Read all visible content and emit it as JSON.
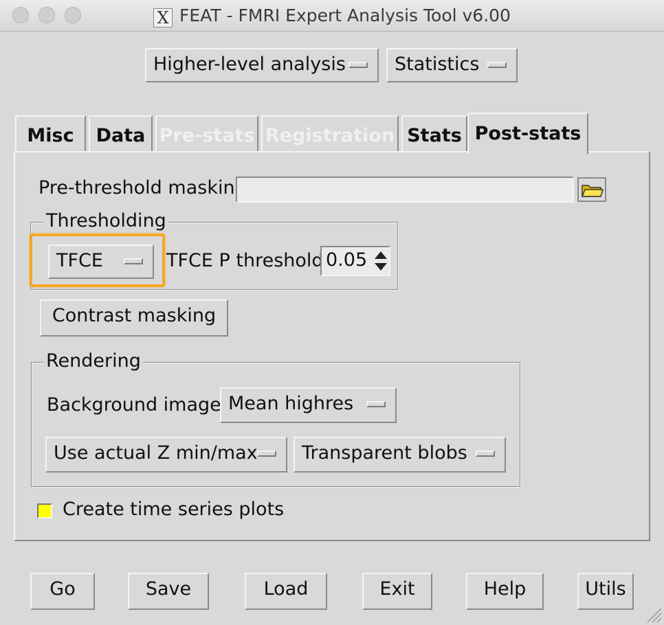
{
  "window": {
    "title": "FEAT - FMRI Expert Analysis Tool v6.00",
    "logo_glyph": "X"
  },
  "top_menus": {
    "analysis_level": "Higher-level analysis",
    "analysis_stage": "Statistics"
  },
  "tabs": [
    {
      "label": "Misc",
      "state": "enabled"
    },
    {
      "label": "Data",
      "state": "enabled"
    },
    {
      "label": "Pre-stats",
      "state": "disabled"
    },
    {
      "label": "Registration",
      "state": "disabled"
    },
    {
      "label": "Stats",
      "state": "enabled"
    },
    {
      "label": "Post-stats",
      "state": "active"
    }
  ],
  "post_stats": {
    "pre_threshold_label": "Pre-threshold masking",
    "pre_threshold_value": "",
    "thresholding": {
      "group_title": "Thresholding",
      "method": "TFCE",
      "p_label": "TFCE P threshold",
      "p_value": "0.05"
    },
    "contrast_masking_label": "Contrast masking",
    "rendering": {
      "group_title": "Rendering",
      "bg_label": "Background image",
      "bg_value": "Mean highres",
      "z_range": "Use actual Z min/max",
      "blob_style": "Transparent blobs"
    },
    "timeseries_label": "Create time series plots",
    "timeseries_checked": true
  },
  "bottom_buttons": {
    "go": "Go",
    "save": "Save",
    "load": "Load",
    "exit": "Exit",
    "help": "Help",
    "utils": "Utils"
  },
  "colors": {
    "background": "#d9d9d9",
    "highlight": "#f5a623",
    "checkbox_fill": "#ffff00",
    "disabled_text": "#f0f0f0"
  }
}
